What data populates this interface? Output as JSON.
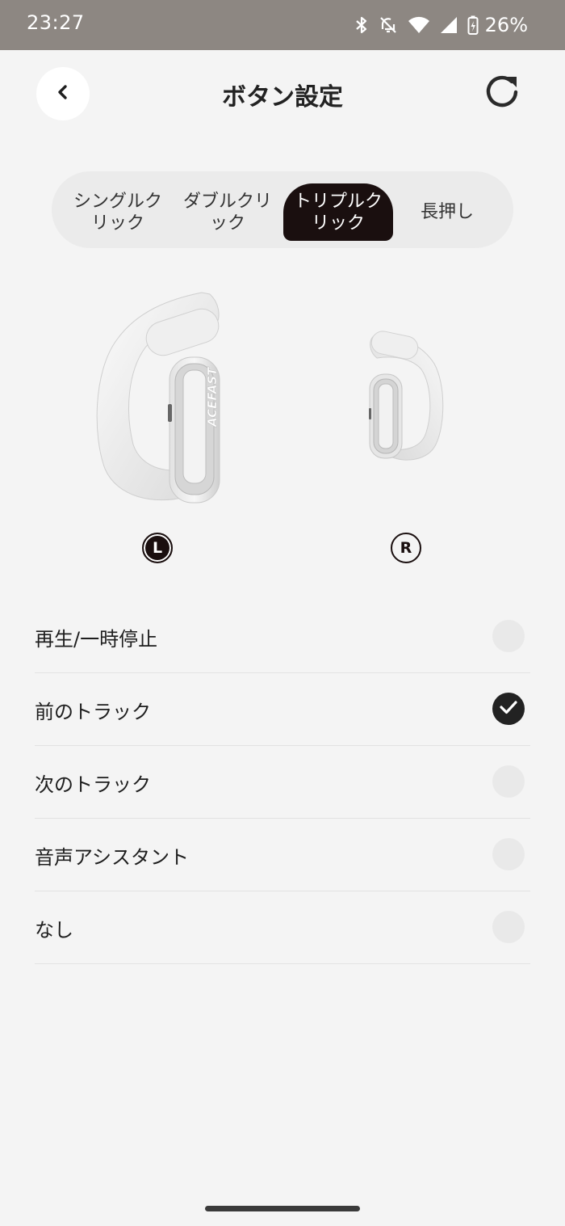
{
  "status_bar": {
    "time": "23:27",
    "battery": "26%",
    "icons": [
      "bluetooth-icon",
      "mute-icon",
      "wifi-icon",
      "signal-icon",
      "battery-icon"
    ]
  },
  "header": {
    "title": "ボタン設定",
    "back_icon": "chevron-left-icon",
    "refresh_icon": "refresh-icon"
  },
  "tabs": [
    {
      "label": "シングルク\nリック",
      "active": false
    },
    {
      "label": "ダブルクリ\nック",
      "active": false
    },
    {
      "label": "トリプルク\nリック",
      "active": true
    },
    {
      "label": "長押し",
      "active": false
    }
  ],
  "earbuds": {
    "left_label": "L",
    "right_label": "R",
    "selected": "L",
    "brand": "ACEFAST"
  },
  "options": [
    {
      "label": "再生/一時停止",
      "checked": false
    },
    {
      "label": "前のトラック",
      "checked": true
    },
    {
      "label": "次のトラック",
      "checked": false
    },
    {
      "label": "音声アシスタント",
      "checked": false
    },
    {
      "label": "なし",
      "checked": false
    }
  ],
  "colors": {
    "status_bar": "#8d8782",
    "background": "#f4f4f4",
    "accent": "#1a0f0f",
    "radio_off": "#e9e9e9"
  }
}
